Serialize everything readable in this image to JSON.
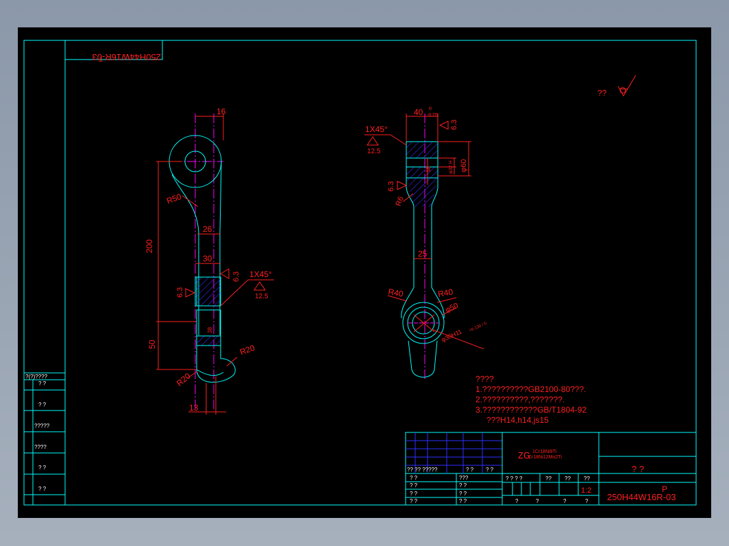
{
  "drawing": {
    "code_mirrored": "250H44W16R-03",
    "code_mirrored_sub": "T",
    "roughness_symbol": "??",
    "colors": {
      "background": "#000000",
      "frame": "#00ffff",
      "dimension": "#ff2020",
      "centerline": "#ff00ff",
      "hatch": "#3030ff",
      "part": "#00ffff",
      "window": "#9aa6b6"
    }
  },
  "left_view": {
    "dim_top": "16",
    "dim_r50": "R50",
    "dim_200": "200",
    "dim_26": "26",
    "dim_30": "30",
    "rough_63_a": "6.3",
    "rough_63_b": "6.3",
    "chamfer": "1X45°",
    "chamfer_rough": "12.5",
    "dim_50": "50",
    "dim_r20_a": "R20",
    "dim_r20_b": "R20",
    "dim_13": "13",
    "small_mark": "38"
  },
  "right_view": {
    "dim_40": "40",
    "dim_40_tol_upper": "0",
    "dim_40_tol_lower": "-0.25",
    "rough_63_top": "6.3",
    "chamfer": "1X45°",
    "chamfer_rough": "12.5",
    "dim_inner": "φ32 H",
    "dim_60": "φ60",
    "rough_63_side": "6.3",
    "dim_r6": "R6",
    "dim_25": "25",
    "dim_r40_a": "R40",
    "dim_r40_b": "R40",
    "dim_phi50": "φ50",
    "dim_bore": "φ30H11",
    "dim_bore_tol": "+0.130 / 0",
    "small_mark": "38"
  },
  "notes": {
    "title": "????",
    "line1": "1.??????????GB2100-80???.",
    "line2": "2.??????????,???????.",
    "line3": "3.????????????GB/T1804-92",
    "line4": "???H14,h14,js15"
  },
  "left_strip": {
    "header": "?(?)????",
    "rows": [
      "?   ?",
      "?   ?",
      "?????",
      "????",
      "?   ?",
      "?   ?"
    ]
  },
  "title_block": {
    "material_prefix": "ZG",
    "material_line1": "1Cr18Ni9Ti",
    "material_line2": "Cr18Ni12Mo2Ti",
    "name": "?   ?",
    "scale": "1:2",
    "letter": "P",
    "drawing_number": "250H44W16R-03",
    "row_labels": [
      "??  ??   ?????",
      "?   ?",
      "?   ?"
    ],
    "sign_cells": [
      "? ?",
      "? ?",
      "? ?",
      "? ?"
    ],
    "sign_cells_right": [
      "???",
      "? ?",
      "? ?",
      "? ?"
    ],
    "stage_headers": [
      "? ? ? ?",
      "??",
      "??",
      "??"
    ],
    "bottom_cells": [
      "?",
      "?",
      "?",
      "?"
    ]
  }
}
